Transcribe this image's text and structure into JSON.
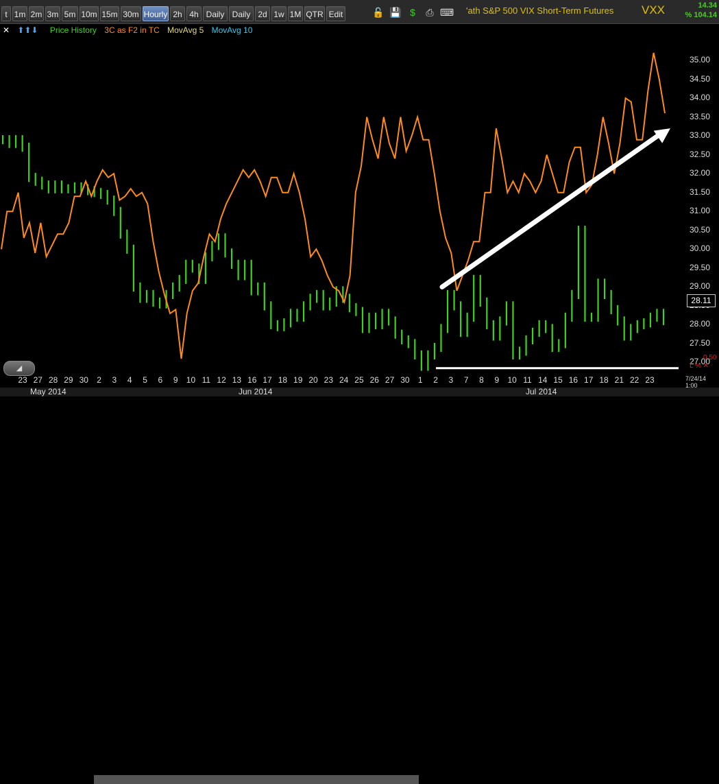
{
  "toolbar": {
    "timeframes": [
      "t",
      "1m",
      "2m",
      "3m",
      "5m",
      "10m",
      "15m",
      "30m",
      "Hourly",
      "2h",
      "4h",
      "Daily",
      "Daily",
      "2d",
      "1w",
      "1M",
      "QTR",
      "Edit"
    ],
    "active": "Hourly",
    "icons": [
      "lock-icon",
      "save-icon",
      "dollar-icon",
      "print-icon",
      "keyboard-icon"
    ]
  },
  "header": {
    "title": "'ath S&P 500 VIX Short-Term Futures",
    "symbol": "VXX",
    "price": "14.34",
    "pct": "% 104.14"
  },
  "legend": {
    "close": "✕",
    "arrows": "⬆⬆⬇",
    "price_history": "Price History",
    "indicator": "3C as F2 in TC",
    "mavg5": "MovAvg 5",
    "mavg10": "MovAvg 10"
  },
  "colors": {
    "price": "#3ed21e",
    "indicator": "#ff8c1a",
    "mavg5": "#e8d87a",
    "mavg10": "#38c8e8",
    "annotation": "#ffffff"
  },
  "yaxis": {
    "labels": [
      "35.00",
      "34.50",
      "34.00",
      "33.50",
      "33.00",
      "32.50",
      "32.00",
      "31.50",
      "31.00",
      "30.50",
      "30.00",
      "29.50",
      "29.00",
      "28.50",
      "28.00",
      "27.50",
      "27.00"
    ],
    "last_price": "28.11",
    "min_label": "0.50",
    "ind_marker": "L % ✕"
  },
  "xaxis": {
    "days": [
      "23",
      "27",
      "28",
      "29",
      "30",
      "2",
      "3",
      "4",
      "5",
      "6",
      "9",
      "10",
      "11",
      "12",
      "13",
      "16",
      "17",
      "18",
      "19",
      "20",
      "23",
      "24",
      "25",
      "26",
      "27",
      "30",
      "1",
      "2",
      "3",
      "7",
      "8",
      "9",
      "10",
      "11",
      "14",
      "15",
      "16",
      "17",
      "18",
      "21",
      "22",
      "23"
    ],
    "months": [
      "May 2014",
      "Jun 2014",
      "Jul 2014"
    ],
    "date_stamp": "7/24/14 1:00"
  },
  "chart_data": {
    "type": "line",
    "series": [
      {
        "name": "Price History",
        "values": [
          32.9,
          32.8,
          32.9,
          32.7,
          31.9,
          31.8,
          31.7,
          31.6,
          31.7,
          31.6,
          31.6,
          31.65,
          31.6,
          31.55,
          31.5,
          31.45,
          31.3,
          31.0,
          30.4,
          30.0,
          29.0,
          28.7,
          28.8,
          28.6,
          28.55,
          28.8,
          29.0,
          29.2,
          29.6,
          29.5,
          29.2,
          29.8,
          30.1,
          30.3,
          29.9,
          29.6,
          29.3,
          29.6,
          28.9,
          29.0,
          28.5,
          28.0,
          27.95,
          28.05,
          28.3,
          28.2,
          28.5,
          28.7,
          28.8,
          28.5,
          28.6,
          28.9,
          28.7,
          28.45,
          28.35,
          27.9,
          28.2,
          28.0,
          28.3,
          28.1,
          27.75,
          27.6,
          27.5,
          27.2,
          26.9,
          27.2,
          27.4,
          27.9,
          28.8,
          28.5,
          27.8,
          28.2,
          29.2,
          28.6,
          28.0,
          27.7,
          28.1,
          28.5,
          27.2,
          27.3,
          27.6,
          27.8,
          28.0,
          27.9,
          27.4,
          27.5,
          28.2,
          28.8,
          30.5,
          28.2,
          28.2,
          29.1,
          28.8,
          28.4,
          28.1,
          27.7,
          27.9,
          28.0,
          28.05,
          28.2,
          28.3,
          28.11
        ]
      },
      {
        "name": "3C as F2 in TC",
        "values": [
          30.0,
          31.0,
          31.0,
          31.5,
          30.3,
          30.7,
          29.9,
          30.7,
          29.8,
          30.1,
          30.4,
          30.4,
          30.7,
          31.4,
          31.4,
          31.8,
          31.4,
          31.8,
          32.1,
          31.9,
          32.0,
          31.3,
          31.4,
          31.6,
          31.4,
          31.5,
          31.2,
          30.2,
          29.4,
          28.8,
          28.3,
          28.4,
          27.1,
          28.3,
          28.9,
          29.1,
          29.8,
          30.4,
          30.2,
          30.8,
          31.2,
          31.5,
          31.8,
          32.1,
          31.9,
          32.1,
          31.8,
          31.4,
          31.9,
          31.9,
          31.5,
          31.5,
          32.0,
          31.5,
          30.8,
          29.8,
          30.0,
          29.7,
          29.3,
          29.0,
          28.9,
          28.6,
          29.3,
          31.5,
          32.2,
          33.5,
          32.9,
          32.4,
          33.5,
          32.8,
          32.4,
          33.5,
          32.6,
          33.0,
          33.5,
          32.9,
          32.9,
          32.0,
          31.0,
          30.3,
          29.9,
          28.9,
          29.3,
          29.7,
          30.2,
          30.2,
          31.5,
          31.5,
          33.2,
          32.4,
          31.5,
          31.8,
          31.5,
          32.0,
          31.8,
          31.5,
          31.8,
          32.5,
          32.0,
          31.5,
          31.5,
          32.3,
          32.7,
          32.7,
          31.5,
          31.7,
          32.5,
          33.5,
          32.8,
          32.0,
          32.8,
          34.0,
          33.9,
          32.9,
          32.9,
          34.2,
          35.2,
          34.5,
          33.6
        ]
      }
    ],
    "annotations": [
      {
        "type": "arrow",
        "from": [
          29.0
        ],
        "to": [
          33.2
        ],
        "label": ""
      },
      {
        "type": "hline",
        "value": 26.85
      }
    ],
    "ylim": [
      26.7,
      35.6
    ],
    "grid": false,
    "legend": "top-left",
    "title": "",
    "xlabel": "",
    "ylabel": ""
  }
}
